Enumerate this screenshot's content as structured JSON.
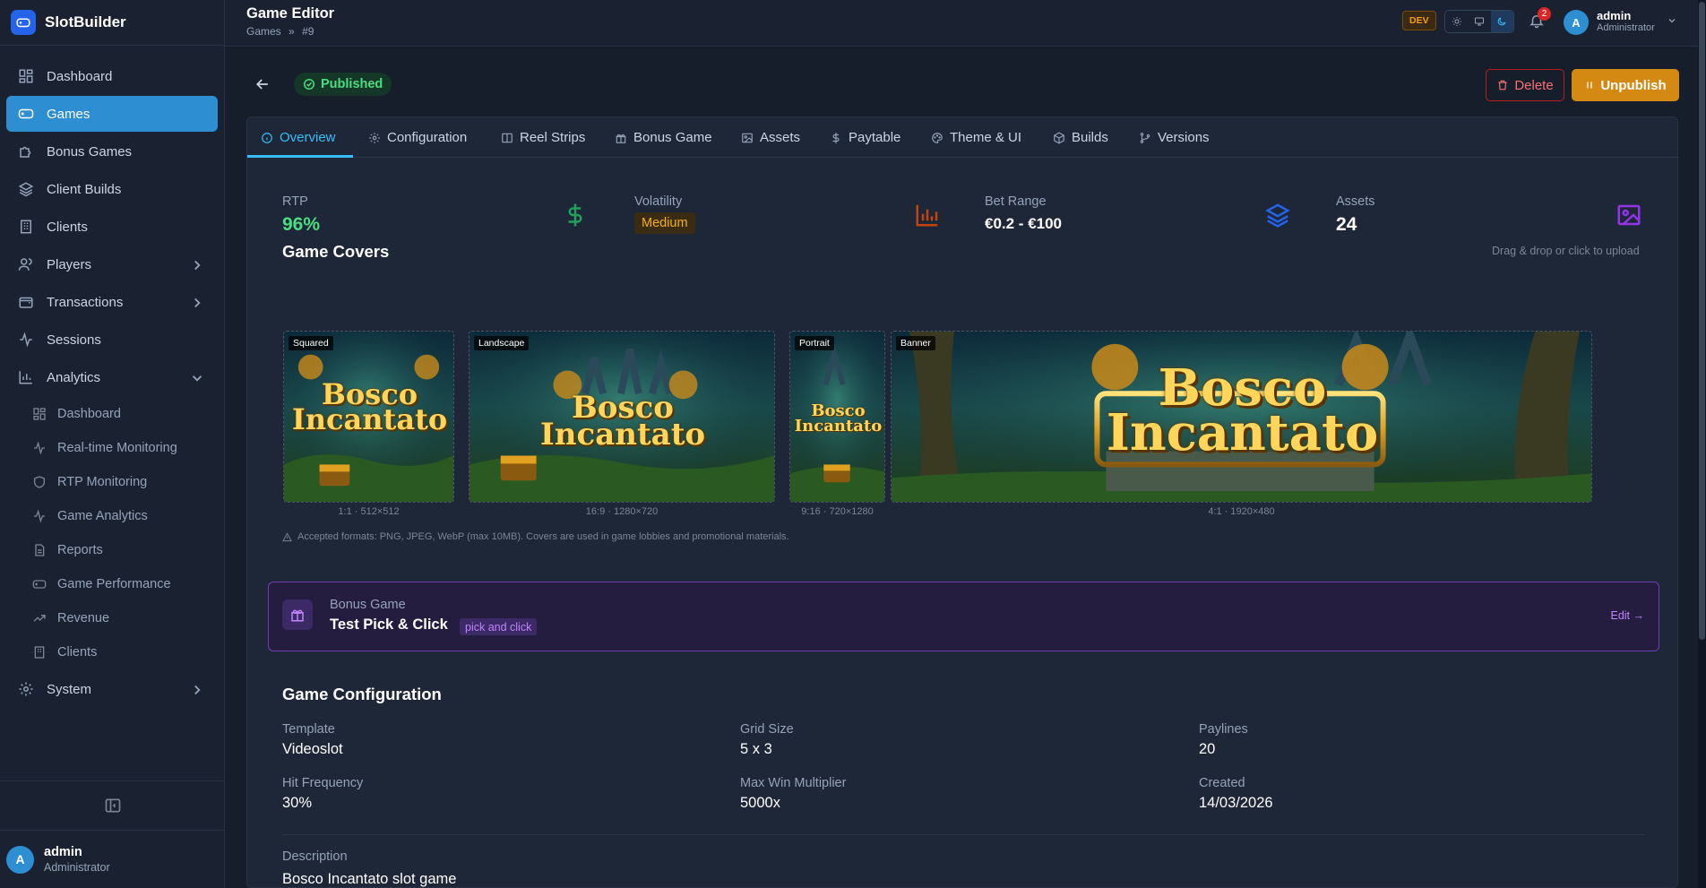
{
  "app": {
    "name": "SlotBuilder"
  },
  "sidebar": {
    "items": [
      {
        "label": "Dashboard",
        "icon": "dashboard-icon"
      },
      {
        "label": "Games",
        "icon": "gamepad-icon",
        "active": true
      },
      {
        "label": "Bonus Games",
        "icon": "puzzle-icon"
      },
      {
        "label": "Client Builds",
        "icon": "layers-icon"
      },
      {
        "label": "Clients",
        "icon": "building-icon"
      },
      {
        "label": "Players",
        "icon": "users-icon"
      },
      {
        "label": "Transactions",
        "icon": "wallet-icon"
      },
      {
        "label": "Sessions",
        "icon": "activity-icon"
      },
      {
        "label": "Analytics",
        "icon": "bar-chart-icon"
      }
    ],
    "analytics_items": [
      {
        "label": "Dashboard"
      },
      {
        "label": "Real-time Monitoring"
      },
      {
        "label": "RTP Monitoring"
      },
      {
        "label": "Game Analytics"
      },
      {
        "label": "Reports"
      },
      {
        "label": "Game Performance"
      },
      {
        "label": "Revenue"
      },
      {
        "label": "Clients"
      }
    ],
    "system_label": "System",
    "user": {
      "initial": "A",
      "name": "admin",
      "role": "Administrator"
    }
  },
  "topbar": {
    "title": "Game Editor",
    "breadcrumb_root": "Games",
    "breadcrumb_sep": "»",
    "breadcrumb_current": "#9",
    "env_badge": "DEV",
    "notification_count": "2",
    "user": {
      "initial": "A",
      "name": "admin",
      "role": "Administrator"
    }
  },
  "header": {
    "status": "Published",
    "delete_label": "Delete",
    "unpublish_label": "Unpublish"
  },
  "tabs": [
    {
      "label": "Overview",
      "active": true
    },
    {
      "label": "Configuration"
    },
    {
      "label": "Reel Strips"
    },
    {
      "label": "Bonus Game"
    },
    {
      "label": "Assets"
    },
    {
      "label": "Paytable"
    },
    {
      "label": "Theme & UI"
    },
    {
      "label": "Builds"
    },
    {
      "label": "Versions"
    }
  ],
  "stats": {
    "rtp": {
      "label": "RTP",
      "value": "96%"
    },
    "volatility": {
      "label": "Volatility",
      "value": "Medium"
    },
    "bet_range": {
      "label": "Bet Range",
      "value": "€0.2 - €100"
    },
    "assets": {
      "label": "Assets",
      "value": "24"
    }
  },
  "covers": {
    "title": "Game Covers",
    "hint": "Drag & drop or click to upload",
    "items": [
      {
        "tag": "Squared",
        "meta": "1:1 · 512×512"
      },
      {
        "tag": "Landscape",
        "meta": "16:9 · 1280×720"
      },
      {
        "tag": "Portrait",
        "meta": "9:16 · 720×1280"
      },
      {
        "tag": "Banner",
        "meta": "4:1 · 1920×480"
      }
    ],
    "game_logo": {
      "line1": "Bosco",
      "line2": "Incantato"
    },
    "note": "Accepted formats: PNG, JPEG, WebP (max 10MB). Covers are used in game lobbies and promotional materials."
  },
  "bonus": {
    "label": "Bonus Game",
    "name": "Test Pick & Click",
    "type": "pick and click",
    "edit": "Edit →"
  },
  "config": {
    "title": "Game Configuration",
    "template": {
      "label": "Template",
      "value": "Videoslot"
    },
    "grid": {
      "label": "Grid Size",
      "value": "5 x 3"
    },
    "paylines": {
      "label": "Paylines",
      "value": "20"
    },
    "hit_frequency": {
      "label": "Hit Frequency",
      "value": "30%"
    },
    "max_win": {
      "label": "Max Win Multiplier",
      "value": "5000x"
    },
    "created": {
      "label": "Created",
      "value": "14/03/2026"
    },
    "description": {
      "label": "Description",
      "value": "Bosco Incantato slot game"
    }
  },
  "colors": {
    "accent": "#2d8ed1",
    "success": "#4ade80",
    "warning": "#d48a12",
    "danger": "#f87171",
    "purple": "#c084fc"
  }
}
